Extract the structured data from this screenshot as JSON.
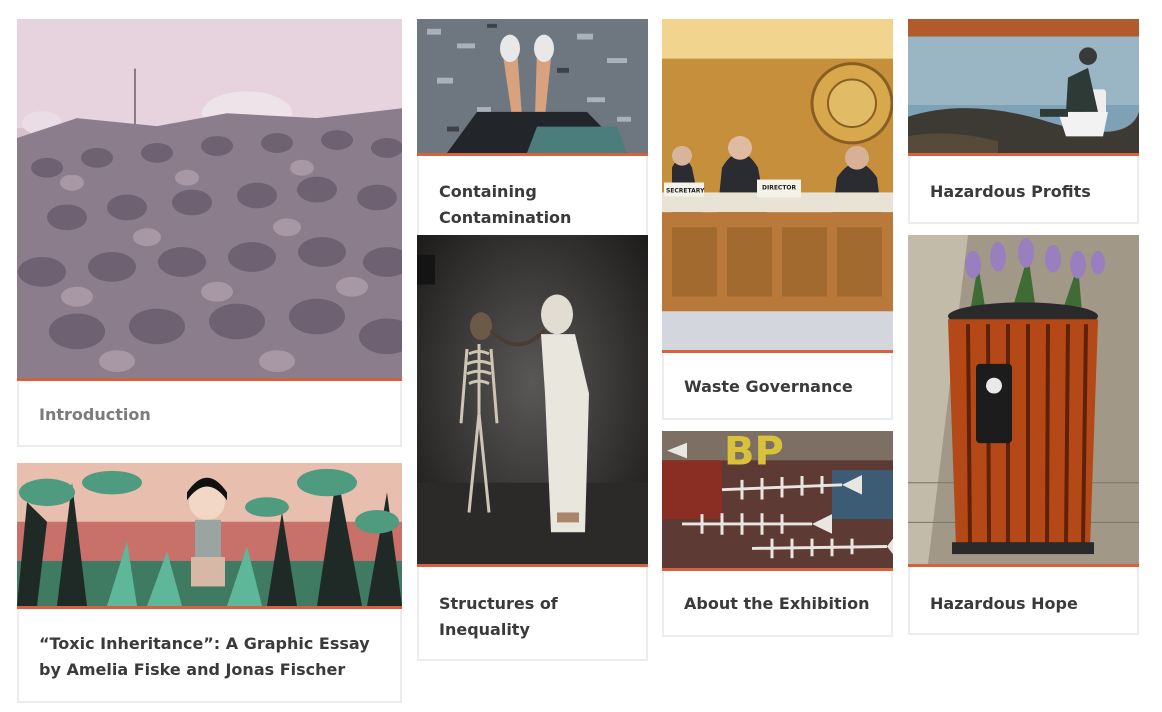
{
  "cards": {
    "introduction": {
      "title": "Introduction",
      "image": "rusted-barrels-pile-image"
    },
    "toxic_inheritance": {
      "title": "“Toxic Inheritance”: A Graphic Essay by Amelia Fiske and Jonas Fischer",
      "image": "comic-girl-in-jungle-image"
    },
    "containing_contamination": {
      "title": "Containing Contamination",
      "image": "feet-on-debris-image"
    },
    "structures_of_inequality": {
      "title": "Structures of Inequality",
      "image": "skeleton-gas-mask-image"
    },
    "waste_governance": {
      "title": "Waste Governance",
      "image": "un-conference-panel-image",
      "image_text": {
        "sign_left": "SECRETARY",
        "sign_right": "DIRECTOR"
      }
    },
    "about_exhibition": {
      "title": "About the Exhibition",
      "image": "fish-skeleton-mural-image",
      "image_text": {
        "mural_letters": "BP"
      }
    },
    "hazardous_profits": {
      "title": "Hazardous Profits",
      "image": "toilet-on-shore-image"
    },
    "hazardous_hope": {
      "title": "Hazardous Hope",
      "image": "flower-trash-bin-image"
    }
  },
  "colors": {
    "accent": "#d6613c",
    "title_text": "#3a3a3a",
    "muted_title": "#7b7b7b",
    "card_border": "#ececec"
  }
}
